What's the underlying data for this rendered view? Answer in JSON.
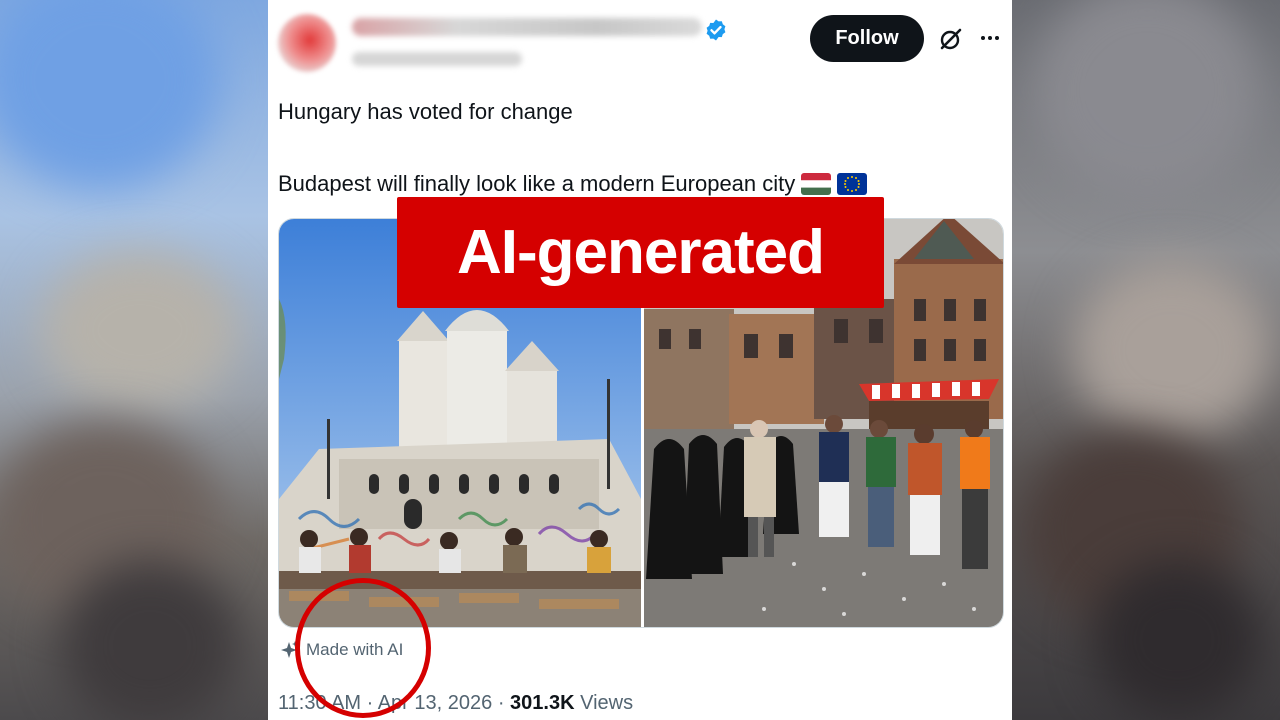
{
  "tweet": {
    "follow_label": "Follow",
    "line1": "Hungary has voted for change",
    "line2": "Budapest will finally look like a modern European city",
    "flags": [
      "hungary-flag",
      "eu-flag"
    ],
    "ai_label": "Made with AI",
    "time": "11:30 AM",
    "separator": "·",
    "date": "Apr 13, 2026",
    "views_count": "301.3K",
    "views_label": "Views"
  },
  "overlay": {
    "banner_text": "AI-generated",
    "accent_color": "#d50000"
  },
  "icons": {
    "verified": "verified-badge-icon",
    "grok": "grok-icon",
    "more": "more-icon",
    "ai": "sparkle-icon"
  }
}
